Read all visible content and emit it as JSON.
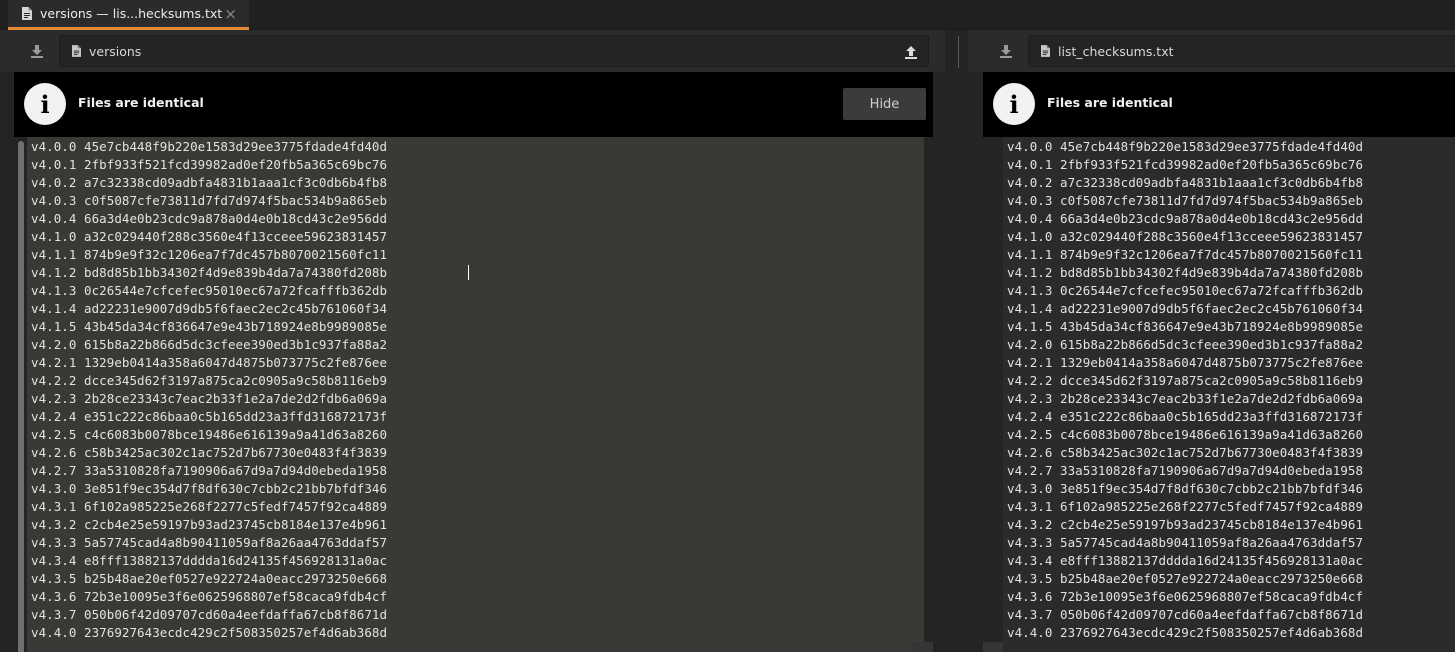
{
  "tab": {
    "title": "versions — lis...hecksums.txt",
    "close_glyph": "×",
    "icon": "document-icon"
  },
  "left": {
    "path": "versions",
    "download_icon": "download-icon",
    "upload_icon": "upload-icon",
    "banner_text": "Files are identical",
    "hide_label": "Hide"
  },
  "right": {
    "path": "list_checksums.txt",
    "download_icon": "download-icon",
    "banner_text": "Files are identical"
  },
  "colors": {
    "accent": "#e68a35",
    "banner_bg": "#000000",
    "text_area_left": "#3b3936",
    "text_area_right": "#2b2b2b"
  },
  "lines": [
    "v4.0.0 45e7cb448f9b220e1583d29ee3775fdade4fd40d",
    "v4.0.1 2fbf933f521fcd39982ad0ef20fb5a365c69bc76",
    "v4.0.2 a7c32338cd09adbfa4831b1aaa1cf3c0db6b4fb8",
    "v4.0.3 c0f5087cfe73811d7fd7d974f5bac534b9a865eb",
    "v4.0.4 66a3d4e0b23cdc9a878a0d4e0b18cd43c2e956dd",
    "v4.1.0 a32c029440f288c3560e4f13cceee59623831457",
    "v4.1.1 874b9e9f32c1206ea7f7dc457b8070021560fc11",
    "v4.1.2 bd8d85b1bb34302f4d9e839b4da7a74380fd208b",
    "v4.1.3 0c26544e7cfcefec95010ec67a72fcafffb362db",
    "v4.1.4 ad22231e9007d9db5f6faec2ec2c45b761060f34",
    "v4.1.5 43b45da34cf836647e9e43b718924e8b9989085e",
    "v4.2.0 615b8a22b866d5dc3cfeee390ed3b1c937fa88a2",
    "v4.2.1 1329eb0414a358a6047d4875b073775c2fe876ee",
    "v4.2.2 dcce345d62f3197a875ca2c0905a9c58b8116eb9",
    "v4.2.3 2b28ce23343c7eac2b33f1e2a7de2d2fdb6a069a",
    "v4.2.4 e351c222c86baa0c5b165dd23a3ffd316872173f",
    "v4.2.5 c4c6083b0078bce19486e616139a9a41d63a8260",
    "v4.2.6 c58b3425ac302c1ac752d7b67730e0483f4f3839",
    "v4.2.7 33a5310828fa7190906a67d9a7d94d0ebeda1958",
    "v4.3.0 3e851f9ec354d7f8df630c7cbb2c21bb7bfdf346",
    "v4.3.1 6f102a985225e268f2277c5fedf7457f92ca4889",
    "v4.3.2 c2cb4e25e59197b93ad23745cb8184e137e4b961",
    "v4.3.3 5a57745cad4a8b90411059af8a26aa4763ddaf57",
    "v4.3.4 e8fff13882137dddda16d24135f456928131a0ac",
    "v4.3.5 b25b48ae20ef0527e922724a0eacc2973250e668",
    "v4.3.6 72b3e10095e3f6e0625968807ef58caca9fdb4cf",
    "v4.3.7 050b06f42d09707cd60a4eefdaffa67cb8f8671d",
    "v4.4.0 2376927643ecdc429c2f508350257ef4d6ab368d"
  ]
}
